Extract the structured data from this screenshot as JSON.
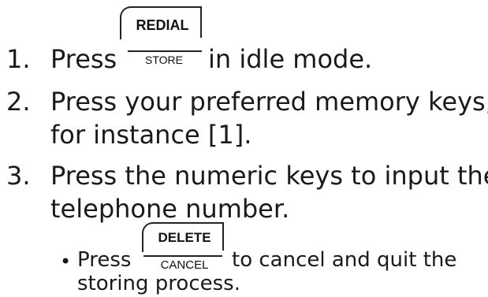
{
  "steps": [
    {
      "number": "1.",
      "before": "Press",
      "after": "in idle mode."
    },
    {
      "number": "2.",
      "line1": "Press your preferred memory keys,",
      "line2": "for instance [1]."
    },
    {
      "number": "3.",
      "line1": "Press the numeric keys to input the",
      "line2": "telephone number."
    }
  ],
  "keys": {
    "redial_store": {
      "top": "REDIAL",
      "bottom": "STORE"
    },
    "delete_cancel": {
      "top": "DELETE",
      "bottom": "CANCEL"
    }
  },
  "sub_step": {
    "bullet": "•",
    "before": "Press",
    "after": "to cancel and quit the",
    "line2": "storing process."
  }
}
